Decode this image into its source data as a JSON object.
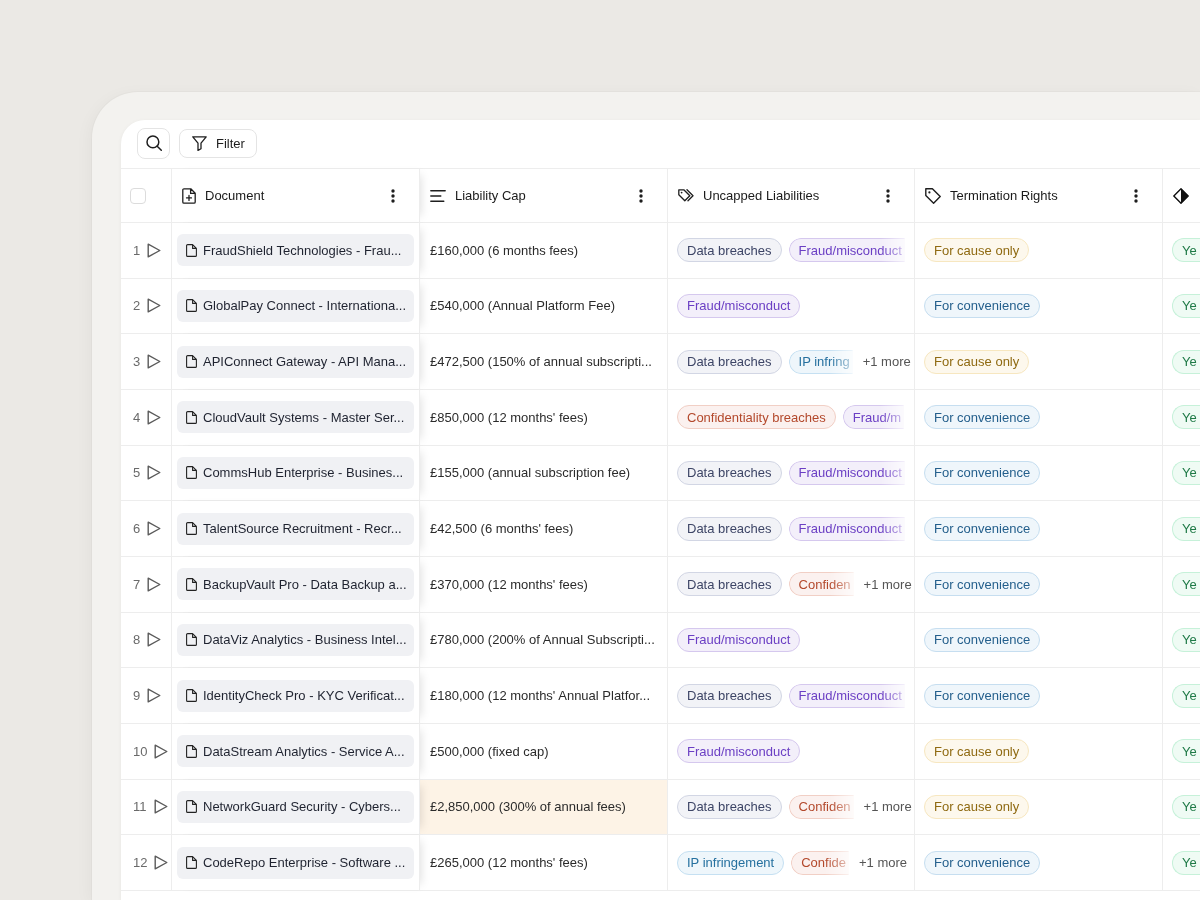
{
  "toolbar": {
    "filter_label": "Filter"
  },
  "table": {
    "select_all": {
      "checked": false
    },
    "columns": [
      {
        "kind": "file",
        "label": "Document"
      },
      {
        "kind": "text",
        "label": "Liability Cap"
      },
      {
        "kind": "multiselect",
        "label": "Uncapped Liabilities"
      },
      {
        "kind": "select",
        "label": "Termination Rights"
      },
      {
        "kind": "boolean"
      }
    ],
    "rows": [
      {
        "number": "1",
        "document": "FraudShield Technologies - Frau...",
        "liability_cap": {
          "text": "£160,000 (6 months fees)",
          "highlighted": false
        },
        "uncapped_liabilities": {
          "tags": [
            {
              "label": "Data breaches",
              "color": "#3d4566",
              "faded": false
            },
            {
              "label": "Fraud/misconduct",
              "color": "#6b3fc4",
              "faded": true
            }
          ]
        },
        "termination_rights": {
          "label": "For cause only",
          "color": "#8f6a12"
        },
        "column_6": {
          "label": "Ye",
          "color": "#1f7a47"
        }
      },
      {
        "number": "2",
        "document": "GlobalPay Connect - Internationa...",
        "liability_cap": {
          "text": "£540,000 (Annual Platform Fee)",
          "highlighted": false
        },
        "uncapped_liabilities": {
          "tags": [
            {
              "label": "Fraud/misconduct",
              "color": "#6b3fc4",
              "faded": false
            }
          ]
        },
        "termination_rights": {
          "label": "For convenience",
          "color": "#245f8c"
        },
        "column_6": {
          "label": "Ye",
          "color": "#1f7a47"
        }
      },
      {
        "number": "3",
        "document": "APIConnect Gateway - API Mana...",
        "liability_cap": {
          "text": "£472,500 (150% of annual subscripti...",
          "highlighted": false
        },
        "uncapped_liabilities": {
          "tags": [
            {
              "label": "Data breaches",
              "color": "#3d4566",
              "faded": false
            },
            {
              "label": "IP infring",
              "color": "#25709f",
              "faded": true
            }
          ],
          "more": "+1 more"
        },
        "termination_rights": {
          "label": "For cause only",
          "color": "#8f6a12"
        },
        "column_6": {
          "label": "Ye",
          "color": "#1f7a47"
        }
      },
      {
        "number": "4",
        "document": "CloudVault Systems - Master Ser...",
        "liability_cap": {
          "text": "£850,000 (12 months' fees)",
          "highlighted": false
        },
        "uncapped_liabilities": {
          "tags": [
            {
              "label": "Confidentiality breaches",
              "color": "#b3482b",
              "faded": false
            },
            {
              "label": "Fraud/m",
              "color": "#6b3fc4",
              "faded": true
            }
          ]
        },
        "termination_rights": {
          "label": "For convenience",
          "color": "#245f8c"
        },
        "column_6": {
          "label": "Ye",
          "color": "#1f7a47"
        }
      },
      {
        "number": "5",
        "document": "CommsHub Enterprise - Busines...",
        "liability_cap": {
          "text": "£155,000 (annual subscription fee)",
          "highlighted": false
        },
        "uncapped_liabilities": {
          "tags": [
            {
              "label": "Data breaches",
              "color": "#3d4566",
              "faded": false
            },
            {
              "label": "Fraud/misconduct",
              "color": "#6b3fc4",
              "faded": true
            }
          ]
        },
        "termination_rights": {
          "label": "For convenience",
          "color": "#245f8c"
        },
        "column_6": {
          "label": "Ye",
          "color": "#1f7a47"
        }
      },
      {
        "number": "6",
        "document": "TalentSource Recruitment - Recr...",
        "liability_cap": {
          "text": "£42,500 (6 months' fees)",
          "highlighted": false
        },
        "uncapped_liabilities": {
          "tags": [
            {
              "label": "Data breaches",
              "color": "#3d4566",
              "faded": false
            },
            {
              "label": "Fraud/misconduct",
              "color": "#6b3fc4",
              "faded": true
            }
          ]
        },
        "termination_rights": {
          "label": "For convenience",
          "color": "#245f8c"
        },
        "column_6": {
          "label": "Ye",
          "color": "#1f7a47"
        }
      },
      {
        "number": "7",
        "document": "BackupVault Pro - Data Backup a...",
        "liability_cap": {
          "text": "£370,000 (12 months' fees)",
          "highlighted": false
        },
        "uncapped_liabilities": {
          "tags": [
            {
              "label": "Data breaches",
              "color": "#3d4566",
              "faded": false
            },
            {
              "label": "Confiden",
              "color": "#b3482b",
              "faded": true
            }
          ],
          "more": "+1 more"
        },
        "termination_rights": {
          "label": "For convenience",
          "color": "#245f8c"
        },
        "column_6": {
          "label": "Ye",
          "color": "#1f7a47"
        }
      },
      {
        "number": "8",
        "document": "DataViz Analytics - Business Intel...",
        "liability_cap": {
          "text": "£780,000 (200% of Annual Subscripti...",
          "highlighted": false
        },
        "uncapped_liabilities": {
          "tags": [
            {
              "label": "Fraud/misconduct",
              "color": "#6b3fc4",
              "faded": false
            }
          ]
        },
        "termination_rights": {
          "label": "For convenience",
          "color": "#245f8c"
        },
        "column_6": {
          "label": "Ye",
          "color": "#1f7a47"
        }
      },
      {
        "number": "9",
        "document": "IdentityCheck Pro - KYC Verificat...",
        "liability_cap": {
          "text": "£180,000 (12 months' Annual Platfor...",
          "highlighted": false
        },
        "uncapped_liabilities": {
          "tags": [
            {
              "label": "Data breaches",
              "color": "#3d4566",
              "faded": false
            },
            {
              "label": "Fraud/misconduct",
              "color": "#6b3fc4",
              "faded": true
            }
          ]
        },
        "termination_rights": {
          "label": "For convenience",
          "color": "#245f8c"
        },
        "column_6": {
          "label": "Ye",
          "color": "#1f7a47"
        }
      },
      {
        "number": "10",
        "document": "DataStream Analytics - Service A...",
        "liability_cap": {
          "text": "£500,000 (fixed cap)",
          "highlighted": false
        },
        "uncapped_liabilities": {
          "tags": [
            {
              "label": "Fraud/misconduct",
              "color": "#6b3fc4",
              "faded": false
            }
          ]
        },
        "termination_rights": {
          "label": "For cause only",
          "color": "#8f6a12"
        },
        "column_6": {
          "label": "Ye",
          "color": "#1f7a47"
        }
      },
      {
        "number": "11",
        "document": "NetworkGuard Security - Cybers...",
        "liability_cap": {
          "text": "£2,850,000 (300% of annual fees)",
          "highlighted": true
        },
        "uncapped_liabilities": {
          "tags": [
            {
              "label": "Data breaches",
              "color": "#3d4566",
              "faded": false
            },
            {
              "label": "Confiden",
              "color": "#b3482b",
              "faded": true
            }
          ],
          "more": "+1 more"
        },
        "termination_rights": {
          "label": "For cause only",
          "color": "#8f6a12"
        },
        "column_6": {
          "label": "Ye",
          "color": "#1f7a47"
        }
      },
      {
        "number": "12",
        "document": "CodeRepo Enterprise - Software ...",
        "liability_cap": {
          "text": "£265,000 (12 months' fees)",
          "highlighted": false
        },
        "uncapped_liabilities": {
          "tags": [
            {
              "label": "IP infringement",
              "color": "#25709f",
              "faded": false
            },
            {
              "label": "Confide",
              "color": "#b3482b",
              "faded": true
            }
          ],
          "more": "+1 more"
        },
        "termination_rights": {
          "label": "For convenience",
          "color": "#245f8c"
        },
        "column_6": {
          "label": "Ye",
          "color": "#1f7a47"
        }
      }
    ]
  }
}
